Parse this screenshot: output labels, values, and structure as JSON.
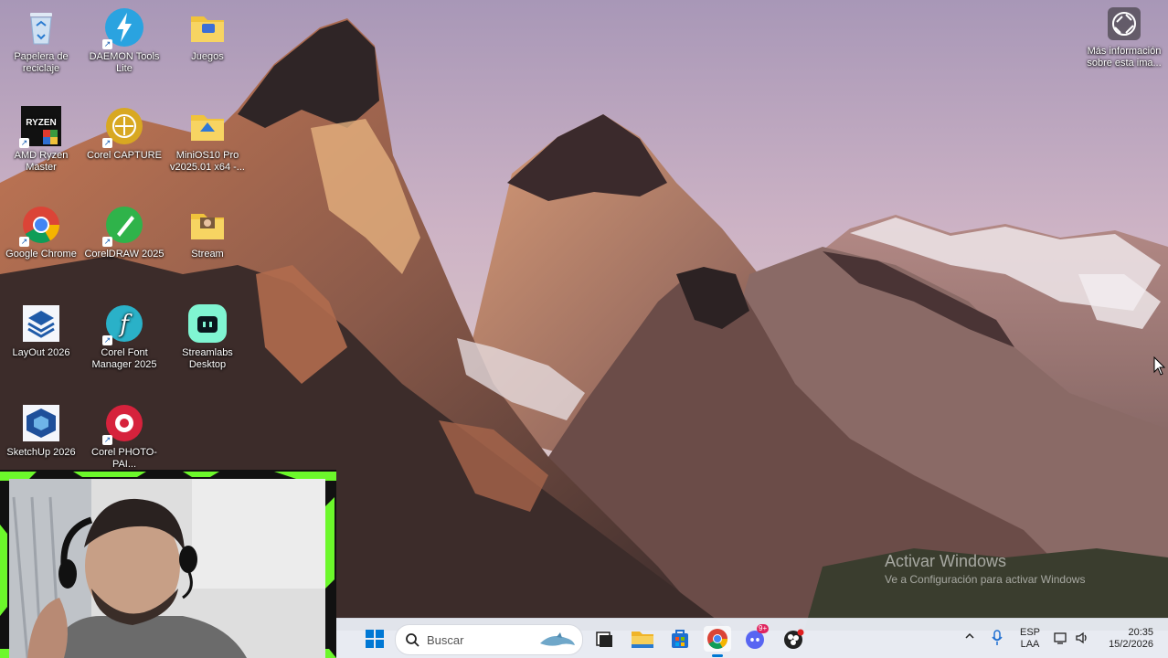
{
  "desktop_icons": [
    {
      "name": "recycle-bin",
      "label": "Papelera de reciclaje"
    },
    {
      "name": "daemon-tools",
      "label": "DAEMON Tools Lite"
    },
    {
      "name": "juegos-folder",
      "label": "Juegos"
    },
    {
      "name": "amd-ryzen-master",
      "label": "AMD Ryzen Master"
    },
    {
      "name": "corel-capture",
      "label": "Corel CAPTURE"
    },
    {
      "name": "minios-folder",
      "label": "MiniOS10 Pro v2025.01 x64 -..."
    },
    {
      "name": "google-chrome",
      "label": "Google Chrome"
    },
    {
      "name": "coreldraw",
      "label": "CorelDRAW 2025"
    },
    {
      "name": "stream-folder",
      "label": "Stream"
    },
    {
      "name": "layout",
      "label": "LayOut 2026"
    },
    {
      "name": "corel-font-manager",
      "label": "Corel Font Manager 2025"
    },
    {
      "name": "streamlabs",
      "label": "Streamlabs Desktop"
    },
    {
      "name": "sketchup",
      "label": "SketchUp 2026"
    },
    {
      "name": "corel-photo-paint",
      "label": "Corel PHOTO-PAI..."
    }
  ],
  "info_button": {
    "label": "Más información sobre esta ima..."
  },
  "watermark": {
    "title": "Activar Windows",
    "subtitle": "Ve a Configuración para activar Windows"
  },
  "taskbar": {
    "search_placeholder": "Buscar",
    "lang": "ESP",
    "layout": "LAA",
    "time": "20:35",
    "date": "15/2/2026",
    "discord_badge": "9+"
  },
  "colors": {
    "webcam_border": "#6cf82b",
    "accent": "#0078d4"
  }
}
